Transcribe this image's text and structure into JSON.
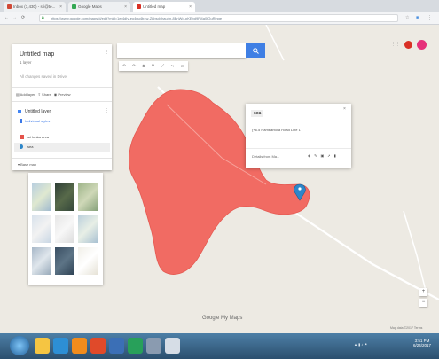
{
  "browser": {
    "tabs": [
      {
        "label": "Inbox (1,430) - sri@te...",
        "favicon_color": "#d14836"
      },
      {
        "label": "Google Maps",
        "favicon_color": "#34a853"
      },
      {
        "label": "Untitled map",
        "favicon_color": "#d93025"
      }
    ],
    "url": "https://www.google.com/maps/d/edit?mid=1er4dIv-eo4uu4b4w-Z8bsd4hau4n-8BnWd-pKEbd9Fl4a0fGuRjnge",
    "nav_icons": [
      "back-icon",
      "forward-icon",
      "reload-icon"
    ]
  },
  "panel": {
    "title": "Untitled map",
    "subtitle": "1 layer",
    "save_status": "All changes saved in Drive",
    "actions": [
      {
        "label": "Add layer",
        "icon": "add-layer-icon"
      },
      {
        "label": "Share",
        "icon": "share-icon"
      },
      {
        "label": "Preview",
        "icon": "preview-icon"
      }
    ],
    "layer": {
      "name": "Untitled layer",
      "style_link": "Individual styles",
      "items": [
        "sri lanka area",
        "sea"
      ]
    },
    "base_map": {
      "label": "Base map"
    }
  },
  "search": {
    "placeholder": ""
  },
  "popup": {
    "title": "sea",
    "coords": "(+6.5 Hambantota Road Line 1",
    "details_label": "Details from Ma..."
  },
  "map": {
    "polygon_color": "#f16b63",
    "marker_color": "#2d86c9",
    "watermark": "Google My Maps",
    "footer": "Map data ©2017  Terms"
  },
  "taskbar": {
    "time": "3:51 PM",
    "date": "6/24/2017",
    "app_colors": [
      "#f5c542",
      "#2d8fd5",
      "#f08c1d",
      "#e04a2a",
      "#3b6fb6",
      "#28a05a",
      "#8a9bb0",
      "#d6dde6"
    ]
  }
}
